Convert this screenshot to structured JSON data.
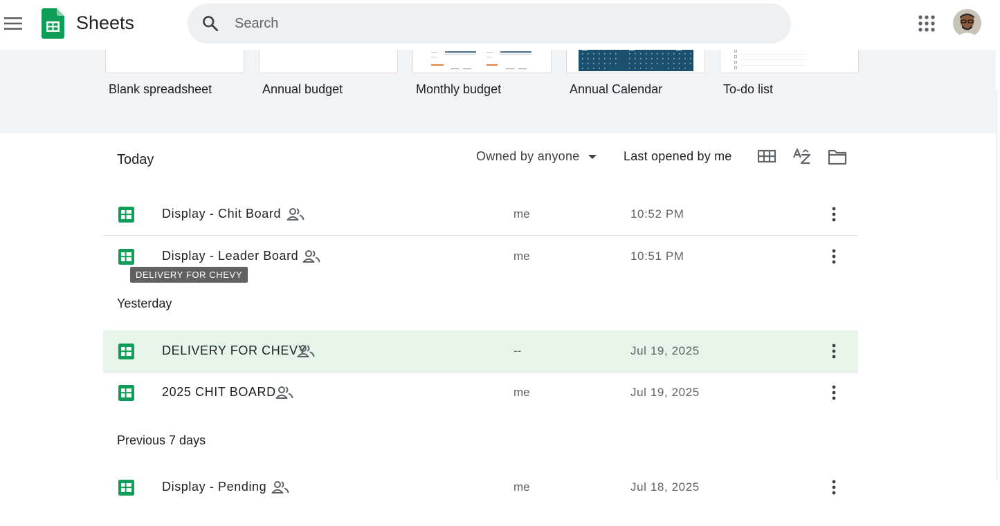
{
  "header": {
    "app_name": "Sheets",
    "search_placeholder": "Search"
  },
  "templates": [
    {
      "label": "Blank spreadsheet"
    },
    {
      "label": "Annual budget"
    },
    {
      "label": "Monthly budget"
    },
    {
      "label": "Annual Calendar"
    },
    {
      "label": "To-do list"
    }
  ],
  "list": {
    "section_title": "Today",
    "owner_filter": "Owned by anyone",
    "sort_label": "Last opened by me",
    "groups": {
      "yesterday": "Yesterday",
      "previous7": "Previous 7 days"
    },
    "rows": [
      {
        "name": "Display - Chit Board",
        "owner": "me",
        "date": "10:52 PM"
      },
      {
        "name": "Display - Leader Board",
        "owner": "me",
        "date": "10:51 PM"
      },
      {
        "name": "DELIVERY FOR CHEVY",
        "owner": "--",
        "date": "Jul 19, 2025"
      },
      {
        "name": "2025 CHIT BOARD",
        "owner": "me",
        "date": "Jul 19, 2025"
      },
      {
        "name": "Display - Pending",
        "owner": "me",
        "date": "Jul 18, 2025"
      }
    ]
  },
  "tooltip": "DELIVERY FOR CHEVY",
  "colors": {
    "sheets_green": "#0f9d58",
    "selected_row": "#e6f4ea",
    "calendar_blue": "#1b4f6e"
  },
  "icons": [
    "menu-icon",
    "sheets-logo-icon",
    "search-icon",
    "apps-grid-icon",
    "grid-view-icon",
    "sort-az-icon",
    "folder-icon",
    "sheets-file-icon",
    "shared-people-icon",
    "more-vert-icon"
  ]
}
